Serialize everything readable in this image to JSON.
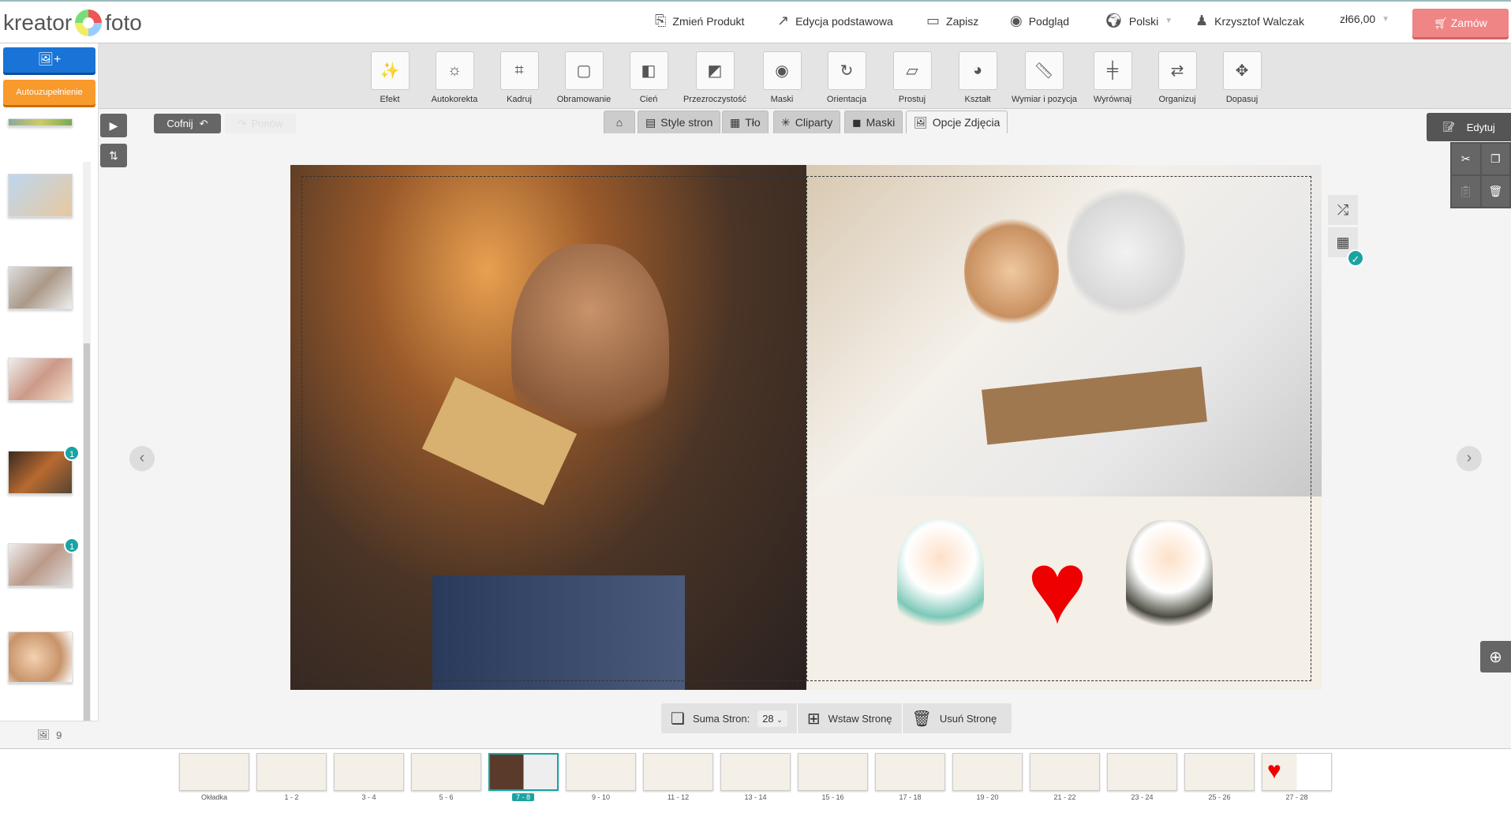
{
  "header": {
    "logo": "kreator foto",
    "nav": [
      {
        "icon": "change-product-icon",
        "label": "Zmień Produkt"
      },
      {
        "icon": "edit-basic-icon",
        "label": "Edycja podstawowa"
      },
      {
        "icon": "save-icon",
        "label": "Zapisz"
      },
      {
        "icon": "eye-icon",
        "label": "Podgląd"
      },
      {
        "icon": "globe-icon",
        "label": "Polski"
      },
      {
        "icon": "user-icon",
        "label": "Krzysztof Walczak"
      }
    ],
    "price": "zł66,00",
    "order": "Zamów"
  },
  "left": {
    "autofill": "Autouzupełnienie",
    "photo_count": "9",
    "badges": [
      "1",
      "1"
    ]
  },
  "tools": [
    "Efekt",
    "Autokorekta",
    "Kadruj",
    "Obramowanie",
    "Cień",
    "Przezroczystość",
    "Maski",
    "Orientacja",
    "Prostuj",
    "Kształt",
    "Wymiar i pozycja",
    "Wyrównaj",
    "Organizuj",
    "Dopasuj"
  ],
  "secbar": {
    "undo": "Cofnij",
    "redo": "Ponów",
    "tabs": [
      "Style stron",
      "Tło",
      "Cliparty",
      "Maski",
      "Opcje Zdjęcia"
    ],
    "edit": "Edytuj"
  },
  "pages": {
    "total_label": "Suma Stron:",
    "total": "28",
    "insert": "Wstaw Stronę",
    "delete": "Usuń Stronę"
  },
  "filmstrip": [
    "Okładka",
    "1 - 2",
    "3 - 4",
    "5 - 6",
    "7 - 8",
    "9 - 10",
    "11 - 12",
    "13 - 14",
    "15 - 16",
    "17 - 18",
    "19 - 20",
    "21 - 22",
    "23 - 24",
    "25 - 26",
    "27 - 28"
  ],
  "active_spread": "7 - 8"
}
